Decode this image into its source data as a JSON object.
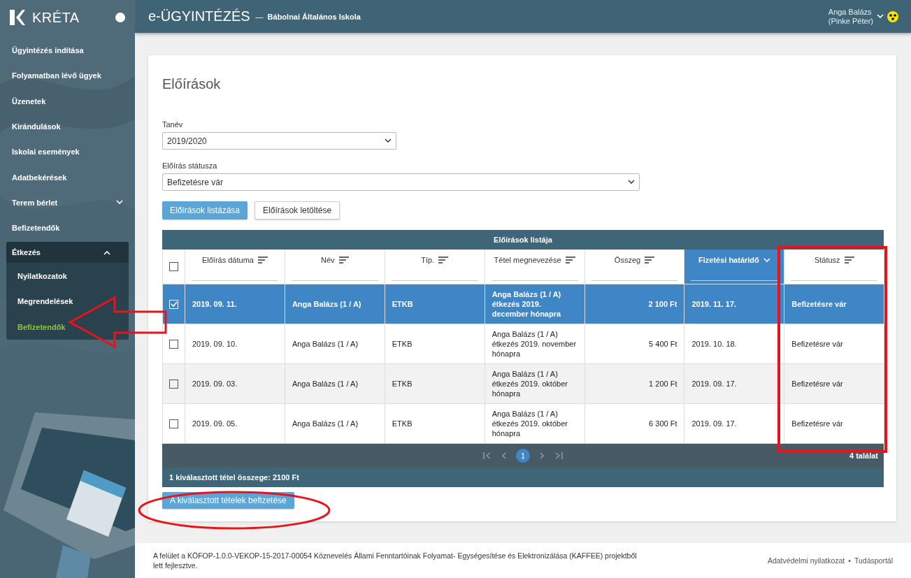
{
  "sidebar": {
    "logo": "KRÉTA",
    "items": [
      {
        "label": "Ügyintézés indítása",
        "selected": false
      },
      {
        "label": "Folyamatban lévő ügyek",
        "selected": false
      },
      {
        "label": "Üzenetek",
        "selected": false
      },
      {
        "label": "Kirándulások",
        "selected": false
      },
      {
        "label": "Iskolai események",
        "selected": false
      },
      {
        "label": "Adatbekérések",
        "selected": false
      },
      {
        "label": "Terem bérlet",
        "selected": false,
        "expanded": false
      },
      {
        "label": "Befizetendők",
        "selected": false
      },
      {
        "label": "Étkezés",
        "selected": false,
        "expanded": true,
        "children": [
          {
            "label": "Nyilatkozatok",
            "selected": false
          },
          {
            "label": "Megrendelések",
            "selected": false
          },
          {
            "label": "Befizetendők",
            "selected": true
          }
        ]
      }
    ]
  },
  "header": {
    "title": "e-ÜGYINTÉZÉS",
    "separator": "—",
    "school": "Bábolnai Általános Iskola",
    "user": "Anga Balázs",
    "user_sub": "(Pinke Péter)"
  },
  "page": {
    "title": "Előírások",
    "fields": [
      {
        "label": "Tanév",
        "value": "2019/2020"
      },
      {
        "label": "Előírás státusza",
        "value": "Befizetésre vár"
      }
    ],
    "buttons": [
      {
        "label": "Előírások listázása",
        "kind": "primary"
      },
      {
        "label": "Előírások letöltése",
        "kind": "secondary"
      }
    ],
    "table": {
      "title": "Előírások listája",
      "all_checked": false,
      "columns": [
        {
          "label": "Előírás dátuma",
          "sorted": false
        },
        {
          "label": "Név",
          "sorted": false
        },
        {
          "label": "Típ.",
          "sorted": false
        },
        {
          "label": "Tétel megnevezése",
          "sorted": false
        },
        {
          "label": "Összeg",
          "sorted": false
        },
        {
          "label": "Fizetési határidő",
          "sorted": true
        },
        {
          "label": "Státusz",
          "sorted": false
        }
      ],
      "rows": [
        {
          "selected": true,
          "cells": [
            "2019. 09. 11.",
            "Anga Balázs (1 / A)",
            "ETKB",
            "Anga Balázs (1 / A) étkezés 2019. december hónapra",
            "2 100 Ft",
            "2019. 11. 17.",
            "Befizetésre vár"
          ]
        },
        {
          "selected": false,
          "cells": [
            "2019. 09. 10.",
            "Anga Balázs (1 / A)",
            "ETKB",
            "Anga Balázs (1 / A) étkezés 2019. november hónapra",
            "5 400 Ft",
            "2019. 10. 18.",
            "Befizetésre vár"
          ]
        },
        {
          "selected": false,
          "cells": [
            "2019. 09. 03.",
            "Anga Balázs (1 / A)",
            "ETKB",
            "Anga Balázs (1 / A) étkezés 2019. október hónapra",
            "1 200 Ft",
            "2019. 09. 17.",
            "Befizetésre vár"
          ]
        },
        {
          "selected": false,
          "cells": [
            "2019. 09. 05.",
            "Anga Balázs (1 / A)",
            "ETKB",
            "Anga Balázs (1 / A) étkezés 2019. október hónapra",
            "6 300 Ft",
            "2019. 09. 17.",
            "Befizetésre vár"
          ]
        }
      ],
      "pages": [
        {
          "label": "1",
          "selected": true
        }
      ],
      "count": "4 találat",
      "summary": "1 kiválasztott tétel összege: 2100 Ft"
    },
    "pay_button": "A kiválasztott tételek befizetése"
  },
  "footer": {
    "text": "A felület a KÖFOP-1.0.0-VEKOP-15-2017-00054 Köznevelés Állami Fenntartóinak Folyamat- Egységesítése és Elektronizálása (KAFFEE) projektből lett fejlesztve.",
    "links": [
      "Adatvédelmi nyilatkozat",
      "Tudásportál"
    ],
    "link_separator": "•"
  }
}
